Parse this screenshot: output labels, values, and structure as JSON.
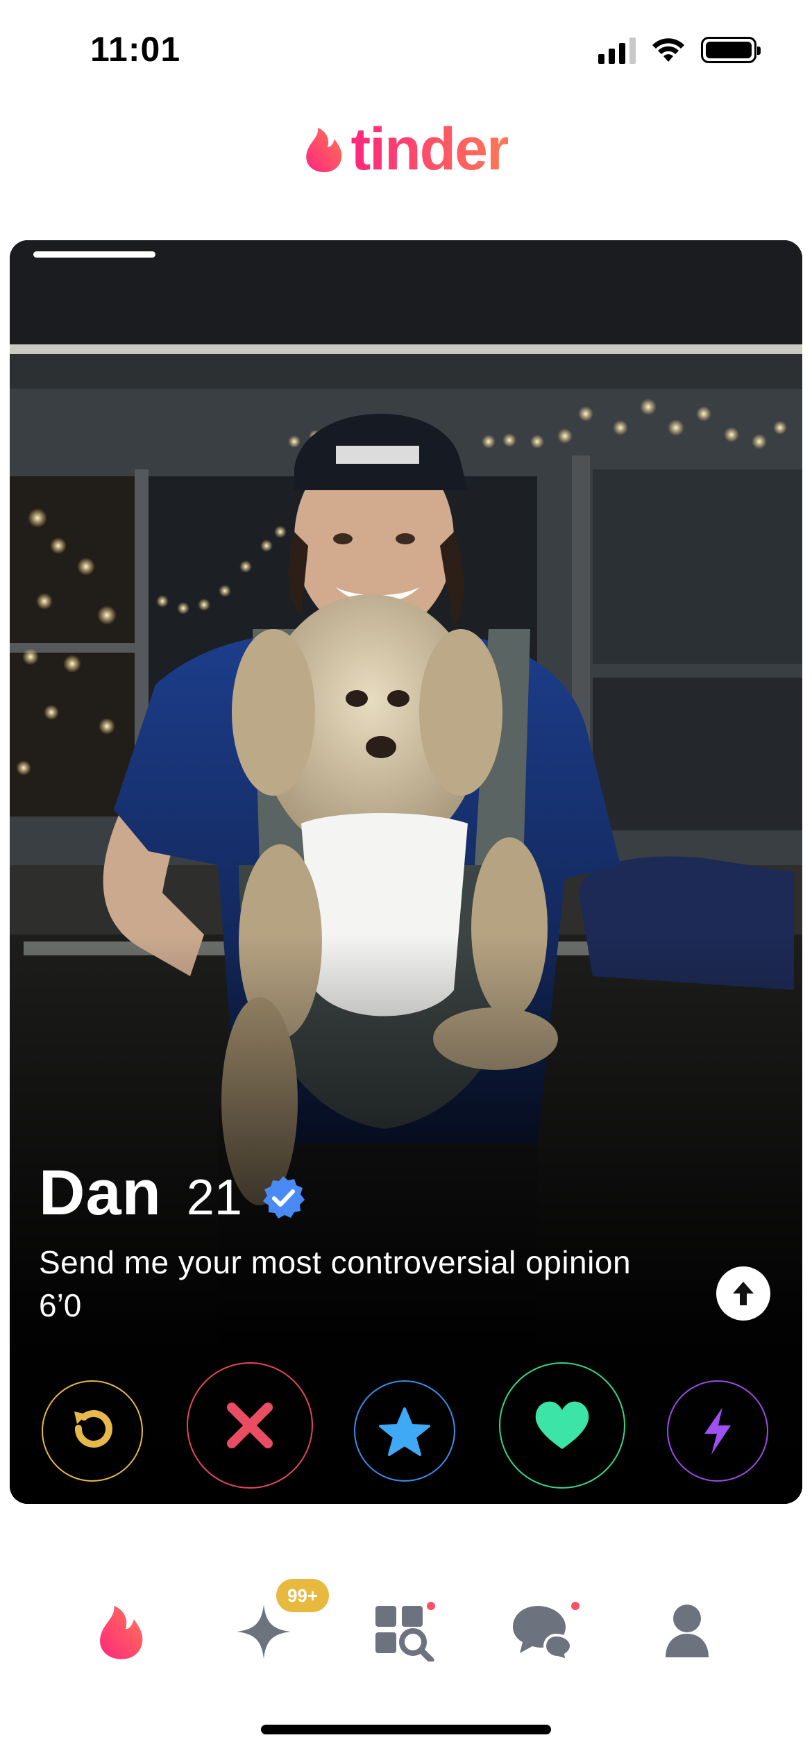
{
  "status_bar": {
    "time": "11:01",
    "icons": [
      "signal-icon",
      "wifi-icon",
      "battery-icon"
    ]
  },
  "header": {
    "logo_text": "tinder",
    "logo_icon": "flame-icon",
    "brand_color": "#fd5068"
  },
  "card": {
    "photo_index": 1,
    "name": "Dan",
    "age": "21",
    "verified": true,
    "bio": "Send me your most controversial opinion",
    "height": "6’0",
    "info_icon": "arrow-up-icon"
  },
  "actions": [
    {
      "name": "rewind",
      "icon": "rewind-icon",
      "color": "#e6b94a"
    },
    {
      "name": "nope",
      "icon": "close-icon",
      "color": "#e0485a"
    },
    {
      "name": "super-like",
      "icon": "star-icon",
      "color": "#3b8eea"
    },
    {
      "name": "like",
      "icon": "heart-icon",
      "color": "#35d48e"
    },
    {
      "name": "boost",
      "icon": "lightning-icon",
      "color": "#9d4be6"
    }
  ],
  "bottom_nav": {
    "items": [
      {
        "name": "home",
        "icon": "flame-icon",
        "active": true
      },
      {
        "name": "gold-home",
        "icon": "sparkle-icon",
        "badge": "99+"
      },
      {
        "name": "explore",
        "icon": "explore-icon",
        "dot": true
      },
      {
        "name": "messages",
        "icon": "chat-icon",
        "dot": true
      },
      {
        "name": "profile",
        "icon": "person-icon"
      }
    ]
  }
}
